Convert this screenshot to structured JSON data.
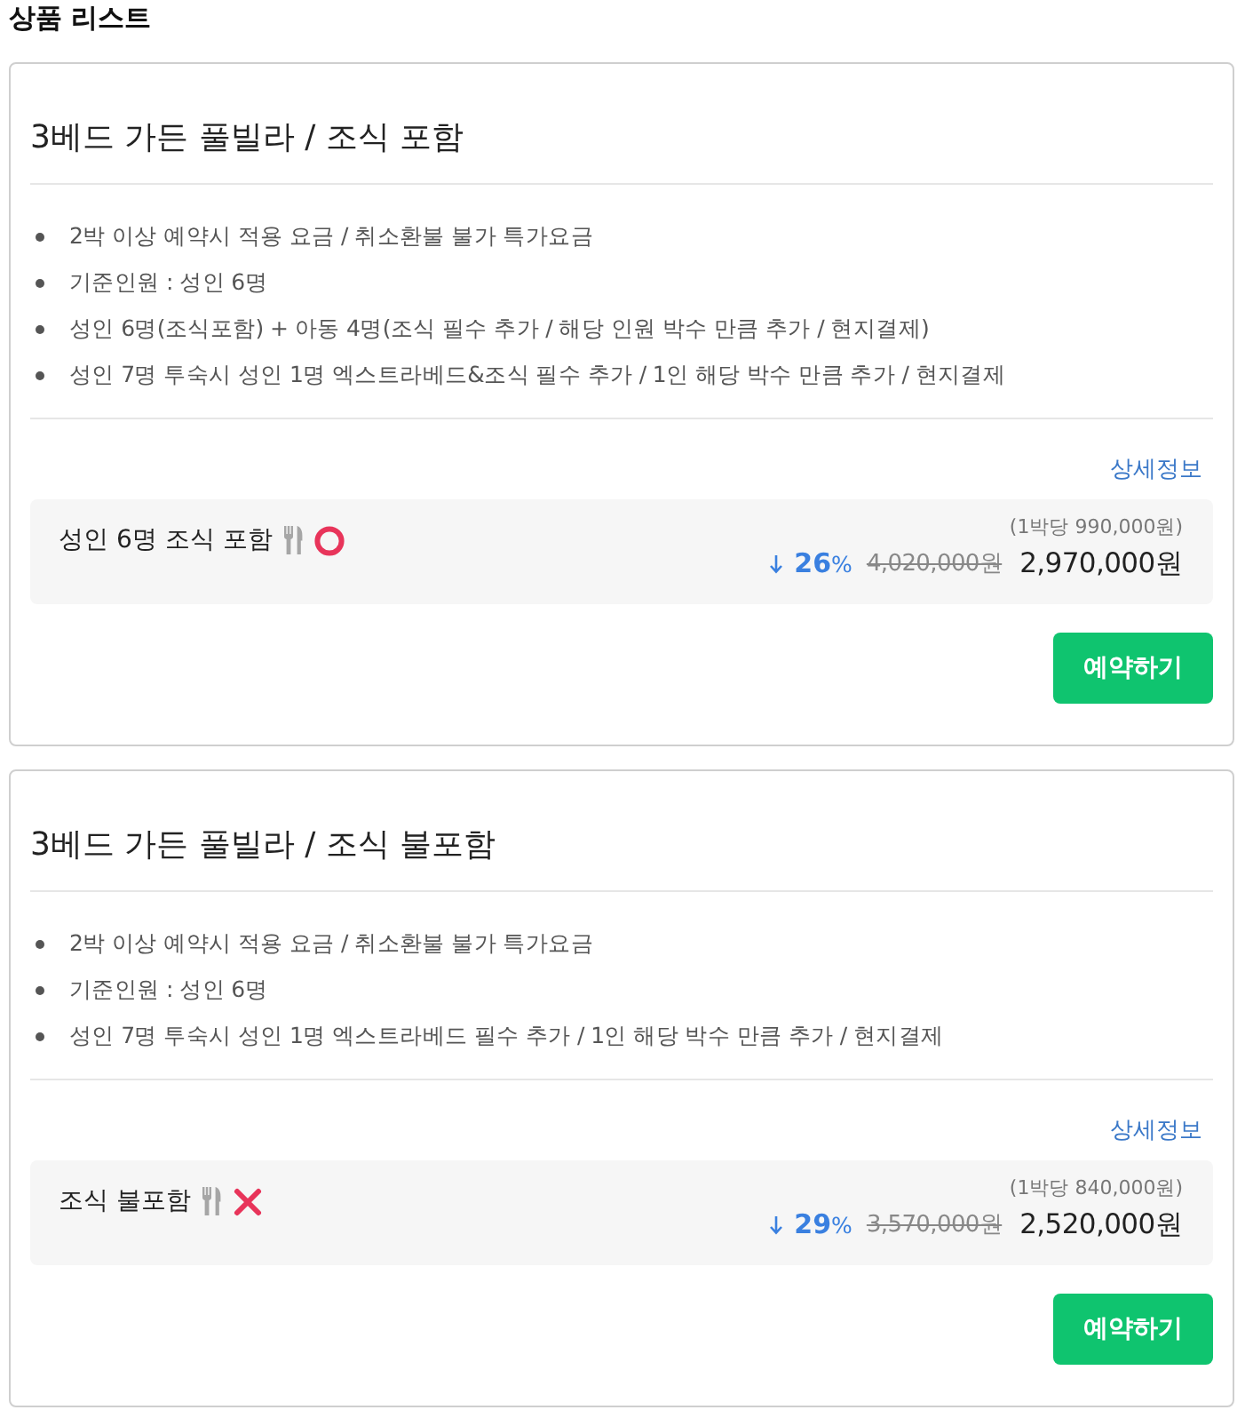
{
  "page": {
    "title": "상품 리스트"
  },
  "products": [
    {
      "title": "3베드 가든 풀빌라 / 조식 포함",
      "notes": [
        "2박 이상 예약시 적용 요금 / 취소환불 불가 특가요금",
        "기준인원 : 성인 6명",
        "성인 6명(조식포함) + 아동 4명(조식 필수 추가 / 해당 인원 박수 만큼 추가 / 현지결제)",
        "성인 7명 투숙시 성인 1명 엑스트라베드&조식 필수 추가 / 1인 해당 박수 만큼 추가 / 현지결제"
      ],
      "detail_link": "상세정보",
      "option": {
        "name": "성인 6명 조식 포함",
        "breakfast": true,
        "per_night": "(1박당 990,000원)",
        "discount": "**26**%",
        "original_price": "4,020,000원",
        "price": "2,970,000원"
      },
      "book_button": "예약하기"
    },
    {
      "title": "3베드 가든 풀빌라 / 조식 불포함",
      "notes": [
        "2박 이상 예약시 적용 요금 / 취소환불 불가 특가요금",
        "기준인원 : 성인 6명",
        "성인 7명 투숙시 성인 1명 엑스트라베드 필수 추가 / 1인 해당 박수 만큼 추가 / 현지결제"
      ],
      "detail_link": "상세정보",
      "option": {
        "name": "조식 불포함",
        "breakfast": false,
        "per_night": "(1박당 840,000원)",
        "discount": "**29**%",
        "original_price": "3,570,000원",
        "price": "2,520,000원"
      },
      "book_button": "예약하기"
    }
  ]
}
